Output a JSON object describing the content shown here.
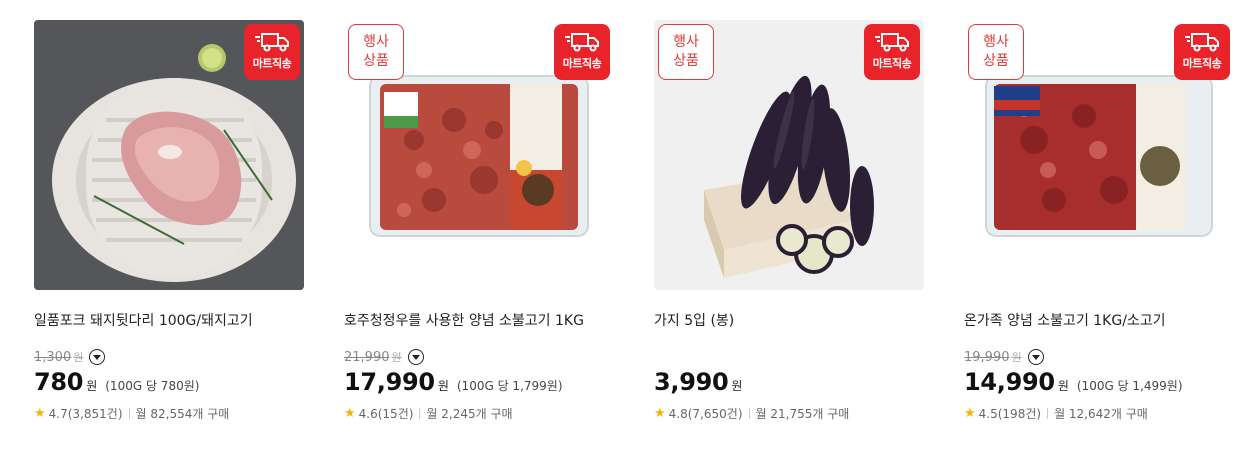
{
  "badges": {
    "event_line1": "행사",
    "event_line2": "상품",
    "mart": "마트직송"
  },
  "products": [
    {
      "title": "일품포크 돼지뒷다리 100G/돼지고기",
      "original_price": "1,300",
      "original_unit": "원",
      "price": "780",
      "price_unit": "원",
      "unit_price": "(100G 당 780원)",
      "rating": "4.7(3,851건)",
      "monthly": "월 82,554개 구매",
      "event": false
    },
    {
      "title": "호주청정우를 사용한 양념 소불고기 1KG",
      "original_price": "21,990",
      "original_unit": "원",
      "price": "17,990",
      "price_unit": "원",
      "unit_price": "(100G 당 1,799원)",
      "rating": "4.6(15건)",
      "monthly": "월 2,245개 구매",
      "event": true
    },
    {
      "title": "가지 5입 (봉)",
      "price": "3,990",
      "price_unit": "원",
      "rating": "4.8(7,650건)",
      "monthly": "월 21,755개 구매",
      "event": true
    },
    {
      "title": "온가족 양념 소불고기 1KG/소고기",
      "original_price": "19,990",
      "original_unit": "원",
      "price": "14,990",
      "price_unit": "원",
      "unit_price": "(100G 당 1,499원)",
      "rating": "4.5(198건)",
      "monthly": "월 12,642개 구매",
      "event": true
    }
  ],
  "colors": {
    "badge_red": "#e8232a",
    "star": "#f5b400"
  }
}
